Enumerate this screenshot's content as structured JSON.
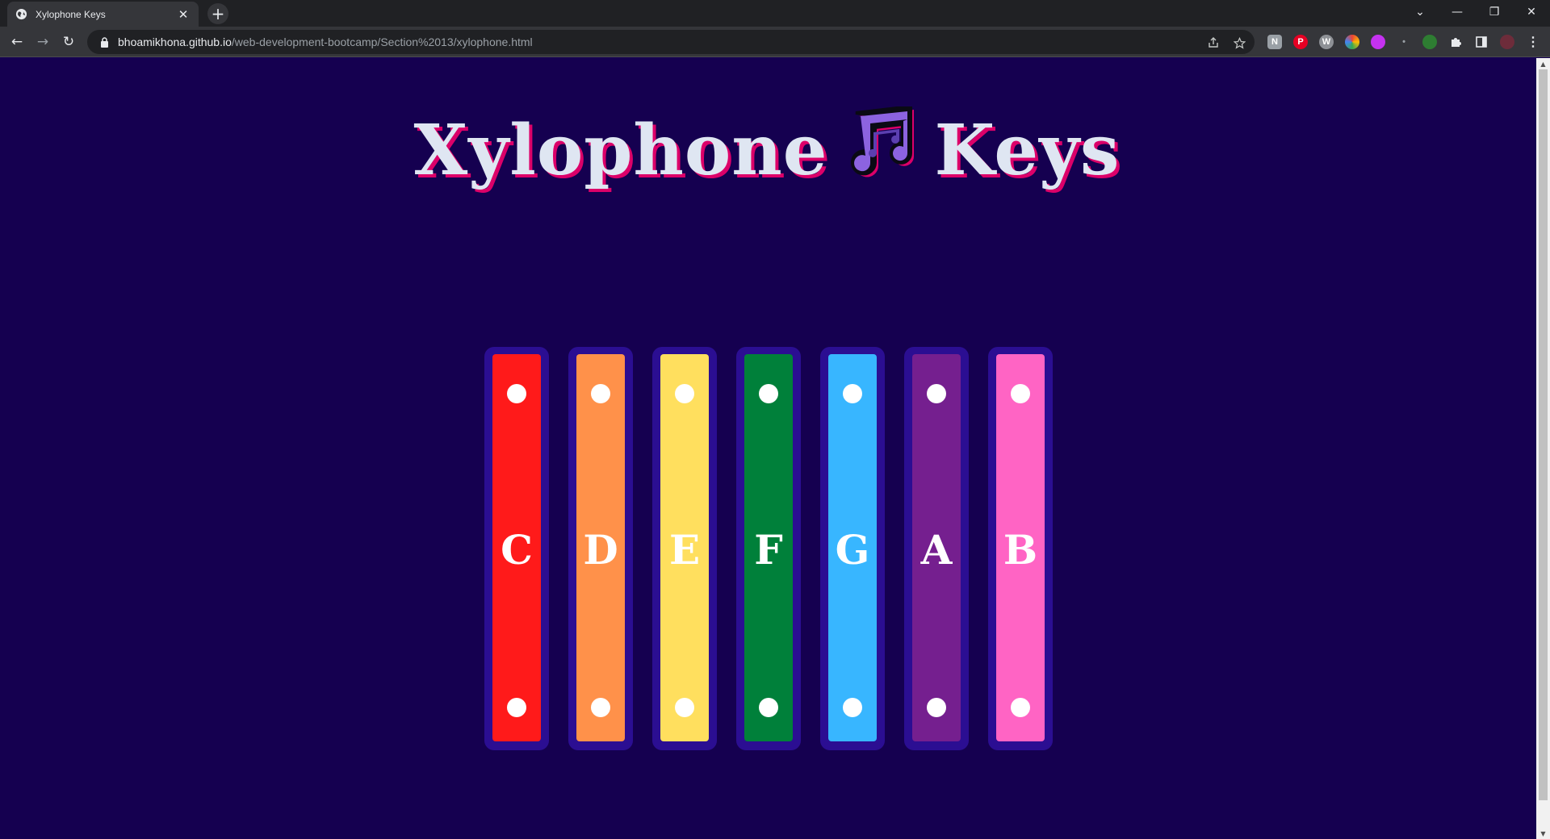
{
  "browser": {
    "tab_title": "Xylophone Keys",
    "tab_close": "✕",
    "new_tab": "+",
    "url_host": "bhoamikhona.github.io",
    "url_path": "/web-development-bootcamp/Section%2013/xylophone.html",
    "window_controls": {
      "tab_search": "⌄",
      "minimize": "—",
      "restore": "❐",
      "close": "✕"
    },
    "nav": {
      "back": "←",
      "forward": "→",
      "reload": "↻"
    },
    "menu": "⋮"
  },
  "page": {
    "title_left": "Xylophone",
    "title_right": "Keys",
    "background_color": "#150050",
    "title_shadow_color": "#dc0069"
  },
  "keys": [
    {
      "note": "C",
      "color": "#ff1a1a"
    },
    {
      "note": "D",
      "color": "#ff914a"
    },
    {
      "note": "E",
      "color": "#ffdf5e"
    },
    {
      "note": "F",
      "color": "#00803a"
    },
    {
      "note": "G",
      "color": "#38b6ff"
    },
    {
      "note": "A",
      "color": "#751f8f"
    },
    {
      "note": "B",
      "color": "#ff64c4"
    }
  ]
}
